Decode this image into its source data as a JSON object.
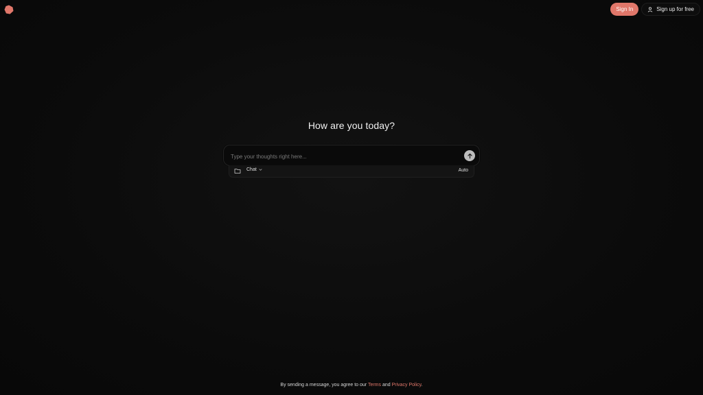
{
  "header": {
    "logo": "app-logo",
    "sign_in_label": "Sign In",
    "sign_up_label": "Sign up for free"
  },
  "main": {
    "headline": "How are you today?",
    "composer": {
      "placeholder": "Type your thoughts right here...",
      "value": ""
    },
    "toolbar": {
      "mode_label": "Chat",
      "auto_label": "Auto"
    }
  },
  "footer": {
    "prefix": "By sending a message, you agree to our ",
    "terms_label": "Terms",
    "and_text": " and ",
    "privacy_label": "Privacy Policy",
    "suffix": "."
  },
  "colors": {
    "accent": "#e0776a",
    "background": "#0b0b0b"
  }
}
